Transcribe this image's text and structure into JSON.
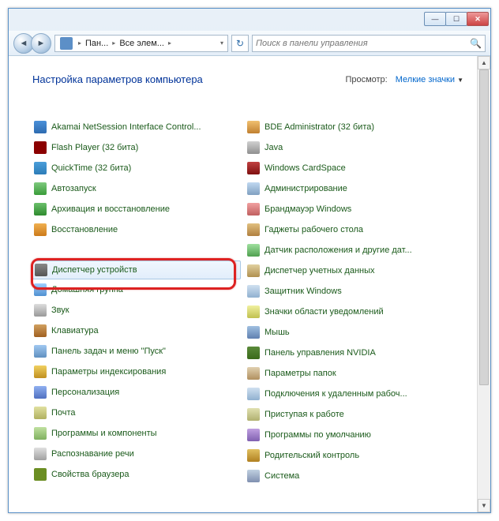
{
  "titlebar": {
    "min": "—",
    "max": "☐",
    "close": "✕"
  },
  "nav": {
    "bc_root": "Пан...",
    "bc_child": "Все элем...",
    "search_placeholder": "Поиск в панели управления"
  },
  "heading": "Настройка параметров компьютера",
  "view": {
    "label": "Просмотр:",
    "value": "Мелкие значки"
  },
  "items_left": [
    {
      "label": "Akamai NetSession Interface Control...",
      "ic": "ic0"
    },
    {
      "label": "Flash Player (32 бита)",
      "ic": "ic1"
    },
    {
      "label": "QuickTime (32 бита)",
      "ic": "ic2"
    },
    {
      "label": "Автозапуск",
      "ic": "ic3"
    },
    {
      "label": "Архивация и восстановление",
      "ic": "ic4"
    },
    {
      "label": "Восстановление",
      "ic": "ic5"
    },
    {
      "label": "",
      "ic": "ic6",
      "hidden": true
    },
    {
      "label": "Диспетчер устройств",
      "ic": "ic6",
      "selected": true
    },
    {
      "label": "Домашняя группа",
      "ic": "ic7"
    },
    {
      "label": "Звук",
      "ic": "ic8"
    },
    {
      "label": "Клавиатура",
      "ic": "ic9"
    },
    {
      "label": "Панель задач и меню \"Пуск\"",
      "ic": "ic10"
    },
    {
      "label": "Параметры индексирования",
      "ic": "ic11"
    },
    {
      "label": "Персонализация",
      "ic": "ic12"
    },
    {
      "label": "Почта",
      "ic": "ic13"
    },
    {
      "label": "Программы и компоненты",
      "ic": "ic14"
    },
    {
      "label": "Распознавание речи",
      "ic": "ic15"
    },
    {
      "label": "Свойства браузера",
      "ic": "ic16"
    }
  ],
  "items_right": [
    {
      "label": "BDE Administrator (32 бита)",
      "ic": "ic17"
    },
    {
      "label": "Java",
      "ic": "ic18"
    },
    {
      "label": "Windows CardSpace",
      "ic": "ic19"
    },
    {
      "label": "Администрирование",
      "ic": "ic20"
    },
    {
      "label": "Брандмауэр Windows",
      "ic": "ic21"
    },
    {
      "label": "Гаджеты рабочего стола",
      "ic": "ic22"
    },
    {
      "label": "Датчик расположения и другие дат...",
      "ic": "ic23"
    },
    {
      "label": "Диспетчер учетных данных",
      "ic": "ic24"
    },
    {
      "label": "Защитник Windows",
      "ic": "ic25"
    },
    {
      "label": "Значки области уведомлений",
      "ic": "ic26"
    },
    {
      "label": "Мышь",
      "ic": "ic27"
    },
    {
      "label": "Панель управления NVIDIA",
      "ic": "ic29"
    },
    {
      "label": "Параметры папок",
      "ic": "ic30"
    },
    {
      "label": "Подключения к удаленным рабоч...",
      "ic": "ic31"
    },
    {
      "label": "Приступая к работе",
      "ic": "ic32"
    },
    {
      "label": "Программы по умолчанию",
      "ic": "ic33"
    },
    {
      "label": "Родительский контроль",
      "ic": "ic34"
    },
    {
      "label": "Система",
      "ic": "ic35"
    }
  ]
}
